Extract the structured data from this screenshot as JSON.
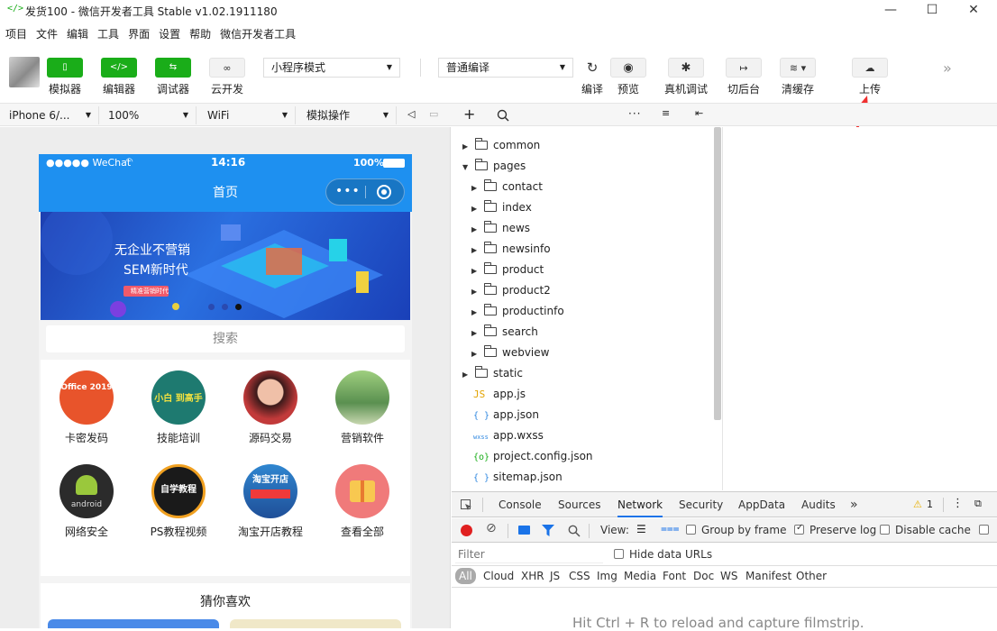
{
  "window": {
    "logo": "</>",
    "title": "发货100 - 微信开发者工具 Stable v1.02.1911180",
    "controls": {
      "minimize": "—",
      "maximize": "☐",
      "close": "✕"
    }
  },
  "menu": [
    "项目",
    "文件",
    "编辑",
    "工具",
    "界面",
    "设置",
    "帮助",
    "微信开发者工具"
  ],
  "toolbar": {
    "simulator": "模拟器",
    "editor": "编辑器",
    "debugger": "调试器",
    "cloud": "云开发",
    "mode_select": "小程序模式",
    "compile_select": "普通编译",
    "compile": "编译",
    "preview": "预览",
    "real_debug": "真机调试",
    "background": "切后台",
    "clear_cache": "清缓存",
    "upload": "上传",
    "more": "»"
  },
  "subbar": {
    "device": "iPhone 6/...",
    "zoom": "100%",
    "network": "WiFi",
    "operation": "模拟操作"
  },
  "phone": {
    "status_signal": "●●●●● WeChat",
    "status_time": "14:16",
    "status_battery": "100%",
    "nav_title": "首页",
    "banner_line1": "无企业不营销",
    "banner_line2": "SEM新时代",
    "banner_tag": "精准营销时代",
    "search_placeholder": "搜索",
    "grid": [
      {
        "label": "卡密发码",
        "icon_text": "Office 2019",
        "color": "#e8542b"
      },
      {
        "label": "技能培训",
        "icon_text": "小白 到高手",
        "color": "#1e7a70"
      },
      {
        "label": "源码交易",
        "icon_text": "",
        "color": "#c23a3a"
      },
      {
        "label": "营销软件",
        "icon_text": "",
        "color": "#7aa860"
      },
      {
        "label": "网络安全",
        "icon_text": "android",
        "color": "#2b2b2b"
      },
      {
        "label": "PS教程视频",
        "icon_text": "自学教程",
        "color": "#1a1a1a"
      },
      {
        "label": "淘宝开店教程",
        "icon_text": "淘宝开店",
        "color": "#1f5fa8"
      },
      {
        "label": "查看全部",
        "icon_text": "",
        "color": "#f07a7a"
      }
    ],
    "guess_title": "猜你喜欢"
  },
  "filetree": [
    {
      "name": "common",
      "type": "folder",
      "level": 0,
      "open": false
    },
    {
      "name": "pages",
      "type": "folder",
      "level": 0,
      "open": true
    },
    {
      "name": "contact",
      "type": "folder",
      "level": 1,
      "open": false
    },
    {
      "name": "index",
      "type": "folder",
      "level": 1,
      "open": false
    },
    {
      "name": "news",
      "type": "folder",
      "level": 1,
      "open": false
    },
    {
      "name": "newsinfo",
      "type": "folder",
      "level": 1,
      "open": false
    },
    {
      "name": "product",
      "type": "folder",
      "level": 1,
      "open": false
    },
    {
      "name": "product2",
      "type": "folder",
      "level": 1,
      "open": false
    },
    {
      "name": "productinfo",
      "type": "folder",
      "level": 1,
      "open": false
    },
    {
      "name": "search",
      "type": "folder",
      "level": 1,
      "open": false
    },
    {
      "name": "webview",
      "type": "folder",
      "level": 1,
      "open": false
    },
    {
      "name": "static",
      "type": "folder",
      "level": 0,
      "open": false
    },
    {
      "name": "app.js",
      "type": "js",
      "level": 0,
      "icon": "JS"
    },
    {
      "name": "app.json",
      "type": "json",
      "level": 0,
      "icon": "{ }"
    },
    {
      "name": "app.wxss",
      "type": "wxss",
      "level": 0,
      "icon": "wxss"
    },
    {
      "name": "project.config.json",
      "type": "config",
      "level": 0,
      "icon": "{o}"
    },
    {
      "name": "sitemap.json",
      "type": "json",
      "level": 0,
      "icon": "{ }"
    }
  ],
  "devtools": {
    "tabs": [
      "Console",
      "Sources",
      "Network",
      "Security",
      "AppData",
      "Audits"
    ],
    "active_tab": "Network",
    "more": "»",
    "warning_count": "1",
    "view_label": "View:",
    "group_by_frame": "Group by frame",
    "preserve_log": "Preserve log",
    "disable_cache": "Disable cache",
    "filter_placeholder": "Filter",
    "hide_data_urls": "Hide data URLs",
    "types": [
      "All",
      "Cloud",
      "XHR",
      "JS",
      "CSS",
      "Img",
      "Media",
      "Font",
      "Doc",
      "WS",
      "Manifest",
      "Other"
    ],
    "hint": "Hit Ctrl + R to reload and capture filmstrip."
  },
  "colors": {
    "accent_green": "#1aad19",
    "nav_blue": "#1e90f0",
    "annotation_red": "#f03030"
  }
}
